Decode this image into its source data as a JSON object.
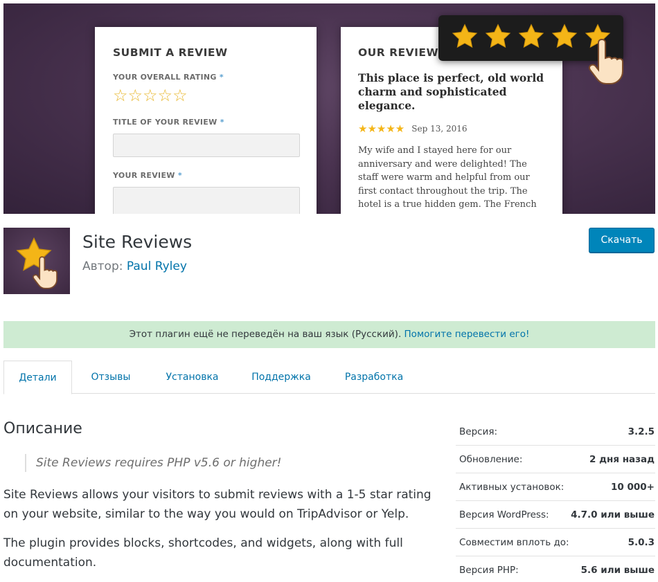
{
  "banner": {
    "submit_heading": "SUBMIT A REVIEW",
    "rating_label": "YOUR OVERALL RATING",
    "title_label": "TITLE OF YOUR REVIEW",
    "review_label": "YOUR REVIEW",
    "required_mark": "*",
    "empty_stars": "☆☆☆☆☆",
    "reviews_heading": "OUR REVIEWS",
    "review_title": "This place is perfect, old world charm and sophisticated elegance.",
    "review_stars": "★★★★★",
    "review_date": "Sep 13, 2016",
    "review_body": "My wife and I stayed here for our anniversary and were delighted! The staff were warm and helpful from our first contact throughout the trip. The hotel is a true hidden gem. The French Studio",
    "popup_rating": 5,
    "star_color": "#f4b517"
  },
  "plugin": {
    "name": "Site Reviews",
    "author_prefix": "Автор:",
    "author_name": "Paul Ryley",
    "download_label": "Скачать"
  },
  "notice": {
    "text": "Этот плагин ещё не переведён на ваш язык (Русский).",
    "link": "Помогите перевести его!"
  },
  "tabs": [
    {
      "label": "Детали",
      "active": true
    },
    {
      "label": "Отзывы",
      "active": false
    },
    {
      "label": "Установка",
      "active": false
    },
    {
      "label": "Поддержка",
      "active": false
    },
    {
      "label": "Разработка",
      "active": false
    }
  ],
  "description": {
    "heading": "Описание",
    "quote": "Site Reviews requires PHP v5.6 or higher!",
    "paragraph1": "Site Reviews allows your visitors to submit reviews with a 1-5 star rating on your website, similar to the way you would on TripAdvisor or Yelp.",
    "paragraph2": "The plugin provides blocks, shortcodes, and widgets, along with full documentation."
  },
  "meta": [
    {
      "key": "Версия:",
      "value": "3.2.5"
    },
    {
      "key": "Обновление:",
      "value": "2 дня назад"
    },
    {
      "key": "Активных установок:",
      "value": "10 000+"
    },
    {
      "key": "Версия WordPress:",
      "value": "4.7.0 или выше"
    },
    {
      "key": "Совместим вплоть до:",
      "value": "5.0.3"
    },
    {
      "key": "Версия PHP:",
      "value": "5.6 или выше"
    }
  ],
  "colors": {
    "link": "#0073aa",
    "button": "#0085ba",
    "notice_bg": "#ceebd2",
    "banner_bg": "#4a3350"
  }
}
